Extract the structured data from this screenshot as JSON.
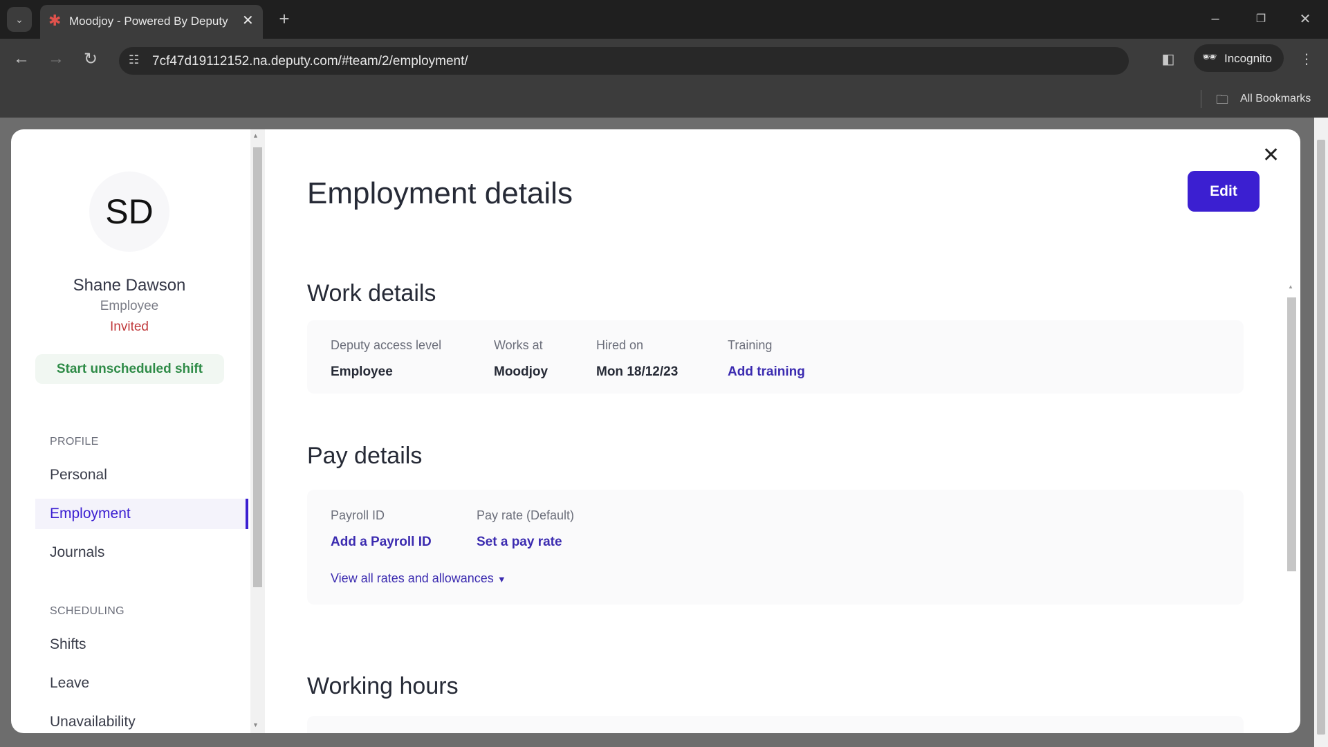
{
  "browser": {
    "tab_title": "Moodjoy - Powered By Deputy",
    "url": "7cf47d19112152.na.deputy.com/#team/2/employment/",
    "incognito_label": "Incognito",
    "bookmarks_label": "All Bookmarks"
  },
  "sidebar": {
    "initials": "SD",
    "name": "Shane Dawson",
    "role": "Employee",
    "status": "Invited",
    "start_shift": "Start unscheduled shift",
    "profile_heading": "PROFILE",
    "profile_items": [
      {
        "label": "Personal"
      },
      {
        "label": "Employment",
        "active": true
      },
      {
        "label": "Journals"
      }
    ],
    "scheduling_heading": "SCHEDULING",
    "scheduling_items": [
      {
        "label": "Shifts"
      },
      {
        "label": "Leave"
      },
      {
        "label": "Unavailability"
      }
    ]
  },
  "main": {
    "title": "Employment details",
    "edit": "Edit",
    "work": {
      "heading": "Work details",
      "fields": [
        {
          "label": "Deputy access level",
          "value": "Employee"
        },
        {
          "label": "Works at",
          "value": "Moodjoy"
        },
        {
          "label": "Hired on",
          "value": "Mon 18/12/23"
        },
        {
          "label": "Training",
          "value": "Add training"
        }
      ]
    },
    "pay": {
      "heading": "Pay details",
      "fields": [
        {
          "label": "Payroll ID",
          "value": "Add a Payroll ID"
        },
        {
          "label": "Pay rate (Default)",
          "value": "Set a pay rate"
        }
      ],
      "view_all": "View all rates and allowances"
    },
    "hours": {
      "heading": "Working hours"
    }
  },
  "colors": {
    "accent": "#3b1fd1",
    "invited": "#c0393b",
    "shift_green": "#2e8b47"
  }
}
